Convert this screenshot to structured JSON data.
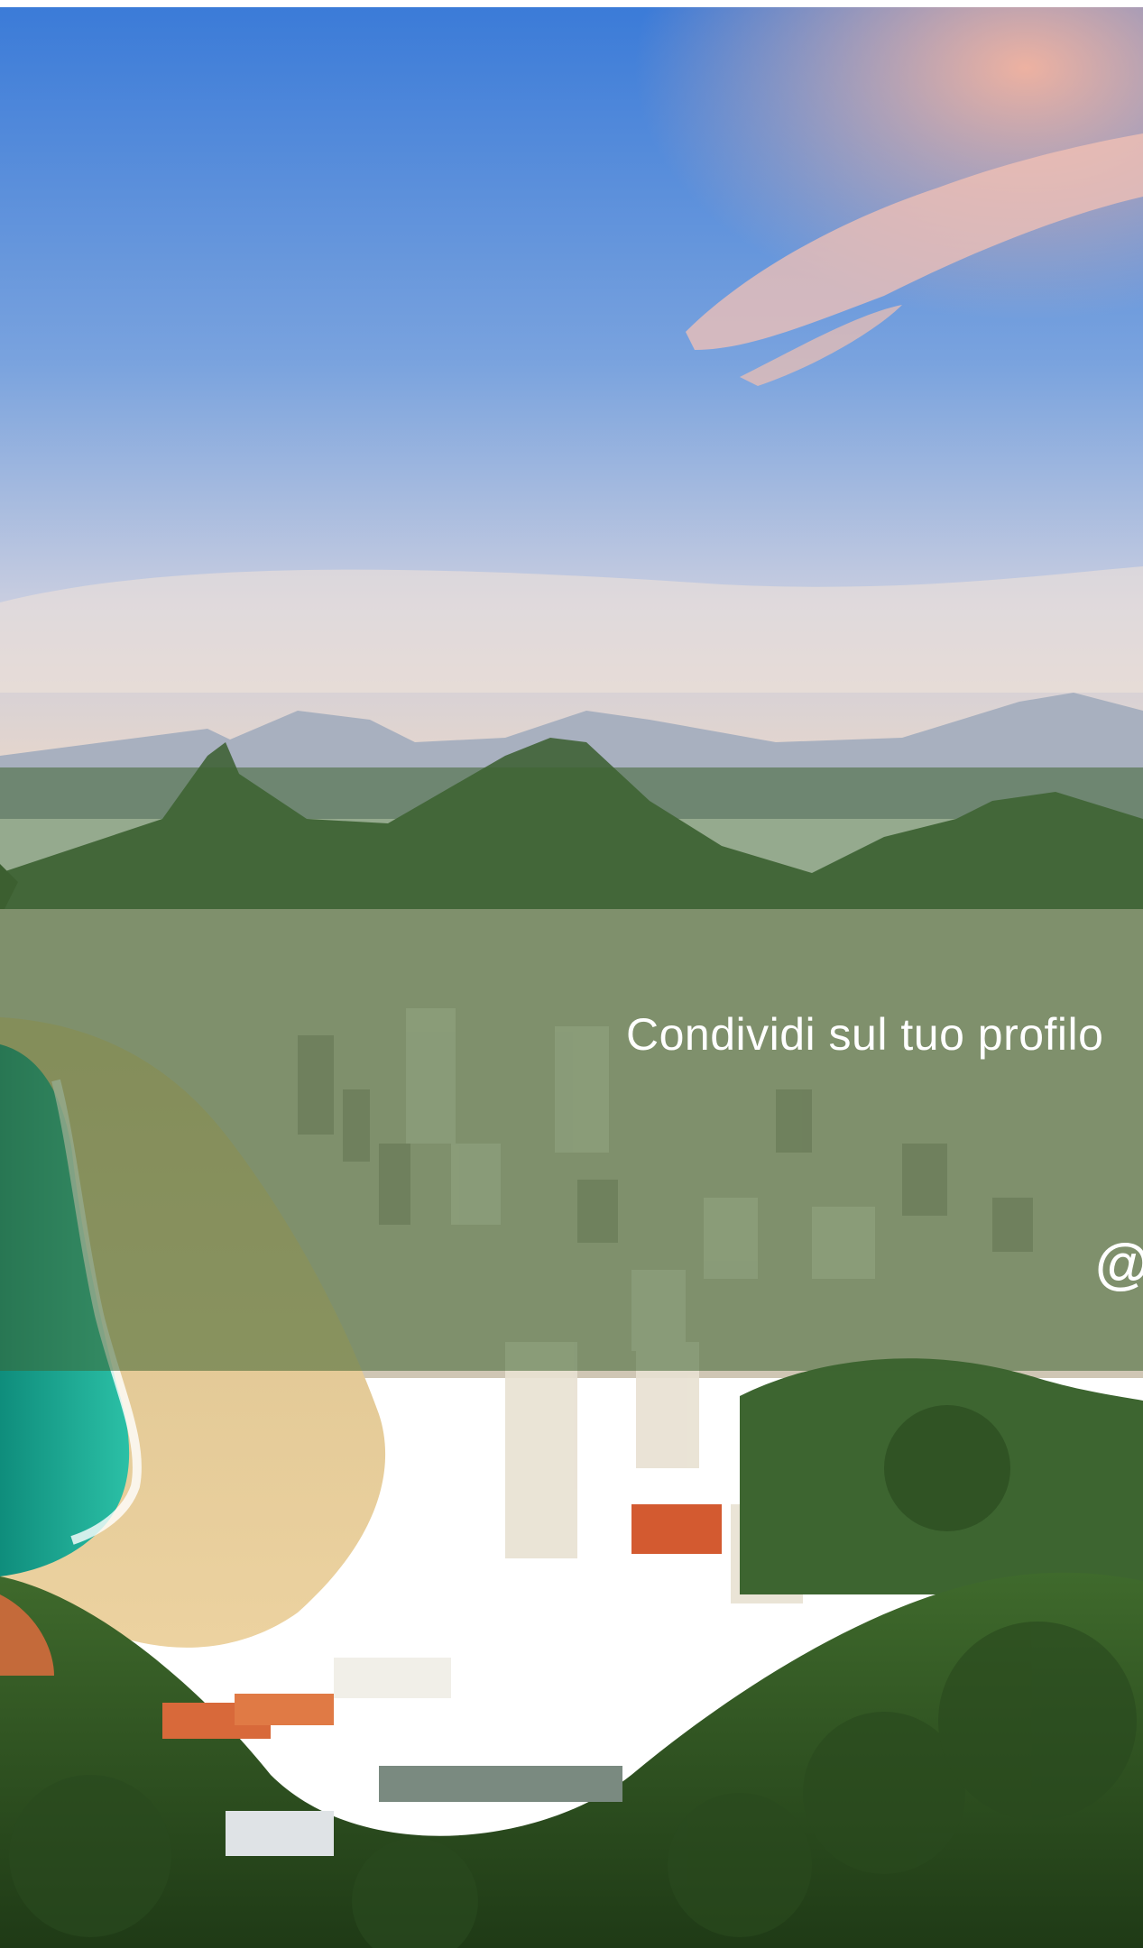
{
  "photo": {
    "subject": "aerial-beach-city-mountains",
    "colors": {
      "sky_top": "#3f7fd6",
      "sky_mid": "#7ea6e0",
      "horizon": "#e9d3c3",
      "cloud_pink": "#f3b7a6",
      "mountain_far": "#9aa3b4",
      "mountain_mid": "#3f5a3a",
      "forest": "#2e4a22",
      "ocean": "#17a58e",
      "sand": "#e3c78e",
      "buildings": "#d9cdb6"
    }
  },
  "share_overlay": {
    "text": "Condividi sul tuo profilo",
    "handle": "@",
    "band_color": "#3e6432"
  }
}
